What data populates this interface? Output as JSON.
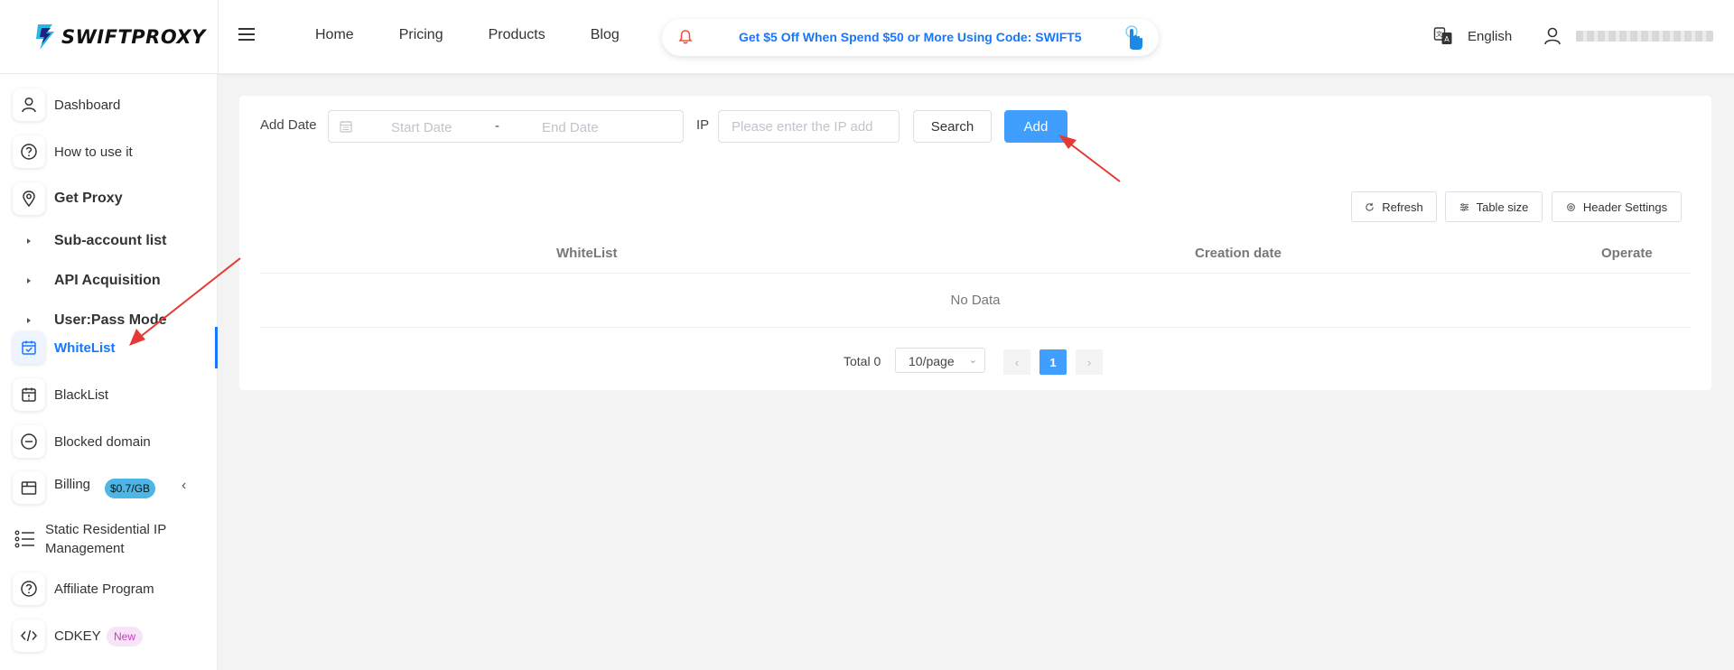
{
  "header": {
    "logo_text": "SWIFTPROXY",
    "nav": [
      "Home",
      "Pricing",
      "Products",
      "Blog"
    ],
    "promo_text": "Get $5 Off When Spend $50 or More Using Code: SWIFT5",
    "language": "English"
  },
  "sidebar": {
    "items": [
      {
        "label": "Dashboard",
        "icon": "user-icon"
      },
      {
        "label": "How to use it",
        "icon": "help-circle-icon"
      },
      {
        "label": "Get Proxy",
        "icon": "location-pin-icon"
      },
      {
        "label": "Sub-account list"
      },
      {
        "label": "API Acquisition"
      },
      {
        "label": "User:Pass Mode"
      },
      {
        "label": "WhiteList",
        "icon": "calendar-check-icon",
        "active": true
      },
      {
        "label": "BlackList",
        "icon": "calendar-alert-icon"
      },
      {
        "label": "Blocked domain",
        "icon": "minus-circle-icon"
      },
      {
        "label": "Billing",
        "icon": "box-icon",
        "badge": "$0.7/GB"
      },
      {
        "label": "Static Residential IP Management",
        "icon": "list-icon"
      },
      {
        "label": "Affiliate Program",
        "icon": "help-circle-icon"
      },
      {
        "label": "CDKEY",
        "icon": "code-icon",
        "badge": "New"
      }
    ]
  },
  "filters": {
    "date_label": "Add Date",
    "start_placeholder": "Start Date",
    "separator": "-",
    "end_placeholder": "End Date",
    "ip_label": "IP",
    "ip_placeholder": "Please enter the IP add",
    "search_label": "Search",
    "add_label": "Add"
  },
  "toolbar": {
    "refresh_label": "Refresh",
    "table_size_label": "Table size",
    "header_settings_label": "Header Settings"
  },
  "table": {
    "columns": [
      "WhiteList",
      "Creation date",
      "Operate"
    ],
    "empty_text": "No Data"
  },
  "pagination": {
    "total_label": "Total 0",
    "page_size": "10/page",
    "current_page": "1"
  },
  "colors": {
    "accent": "#1677ff",
    "primary_button": "#409eff",
    "annotation_arrow": "#e53935"
  }
}
